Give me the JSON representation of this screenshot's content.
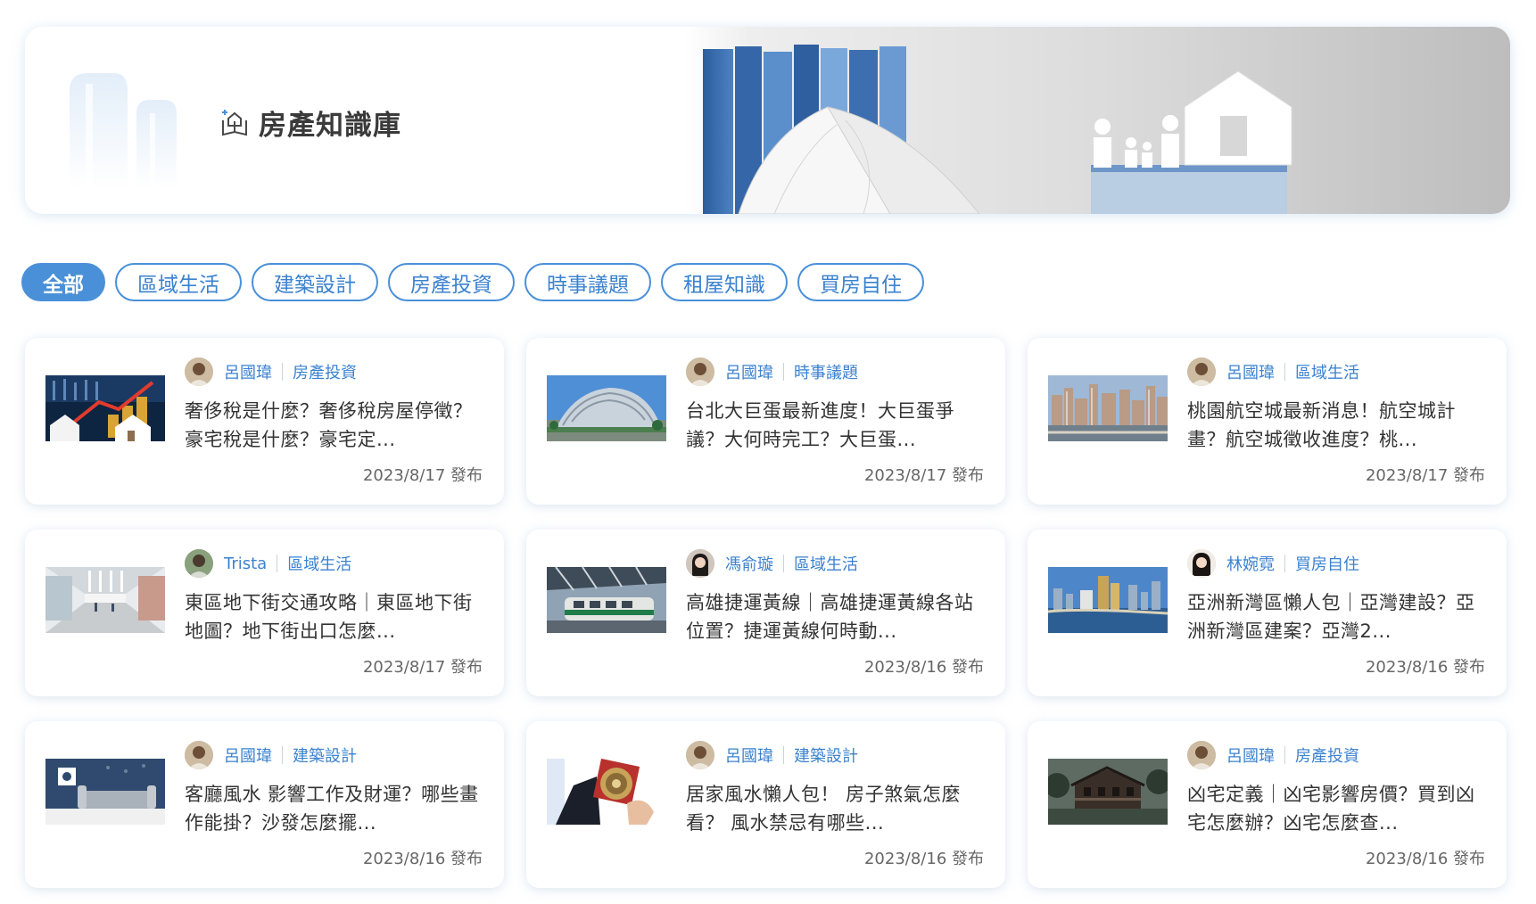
{
  "banner": {
    "title": "房產知識庫"
  },
  "tabs": [
    {
      "label": "全部",
      "active": true
    },
    {
      "label": "區域生活"
    },
    {
      "label": "建築設計"
    },
    {
      "label": "房產投資"
    },
    {
      "label": "時事議題"
    },
    {
      "label": "租屋知識"
    },
    {
      "label": "買房自住"
    }
  ],
  "articles": [
    {
      "author": "呂國瑋",
      "category": "房產投資",
      "title": "奢侈稅是什麼？奢侈稅房屋停徵？豪宅稅是什麼？豪宅定...",
      "date": "2023/8/17 發布",
      "thumb": "houses-coins"
    },
    {
      "author": "呂國瑋",
      "category": "時事議題",
      "title": "台北大巨蛋最新進度！大巨蛋爭議？大何時完工？大巨蛋...",
      "date": "2023/8/17 發布",
      "thumb": "dome"
    },
    {
      "author": "呂國瑋",
      "category": "區域生活",
      "title": "桃園航空城最新消息！航空城計畫？航空城徵收進度？桃...",
      "date": "2023/8/17 發布",
      "thumb": "city"
    },
    {
      "author": "Trista",
      "category": "區域生活",
      "title": "東區地下街交通攻略｜東區地下街地圖？地下街出口怎麼...",
      "date": "2023/8/17 發布",
      "thumb": "underground"
    },
    {
      "author": "馮俞璇",
      "category": "區域生活",
      "title": "高雄捷運黃線｜高雄捷運黃線各站位置？捷運黃線何時動...",
      "date": "2023/8/16 發布",
      "thumb": "metro"
    },
    {
      "author": "林婉霓",
      "category": "買房自住",
      "title": "亞洲新灣區懶人包｜亞灣建設？亞洲新灣區建案？亞灣2...",
      "date": "2023/8/16 發布",
      "thumb": "harbor"
    },
    {
      "author": "呂國瑋",
      "category": "建築設計",
      "title": "客廳風水 影響工作及財運？哪些畫作能掛？沙發怎麼擺...",
      "date": "2023/8/16 發布",
      "thumb": "living-room"
    },
    {
      "author": "呂國瑋",
      "category": "建築設計",
      "title": "居家風水懶人包！ 房子煞氣怎麼看？ 風水禁忌有哪些...",
      "date": "2023/8/16 發布",
      "thumb": "compass"
    },
    {
      "author": "呂國瑋",
      "category": "房產投資",
      "title": "凶宅定義｜凶宅影響房價？買到凶宅怎麼辦？凶宅怎麼查...",
      "date": "2023/8/16 發布",
      "thumb": "haunted-house"
    }
  ],
  "colors": {
    "accent": "#4a90d9",
    "link": "#3b82cf"
  }
}
